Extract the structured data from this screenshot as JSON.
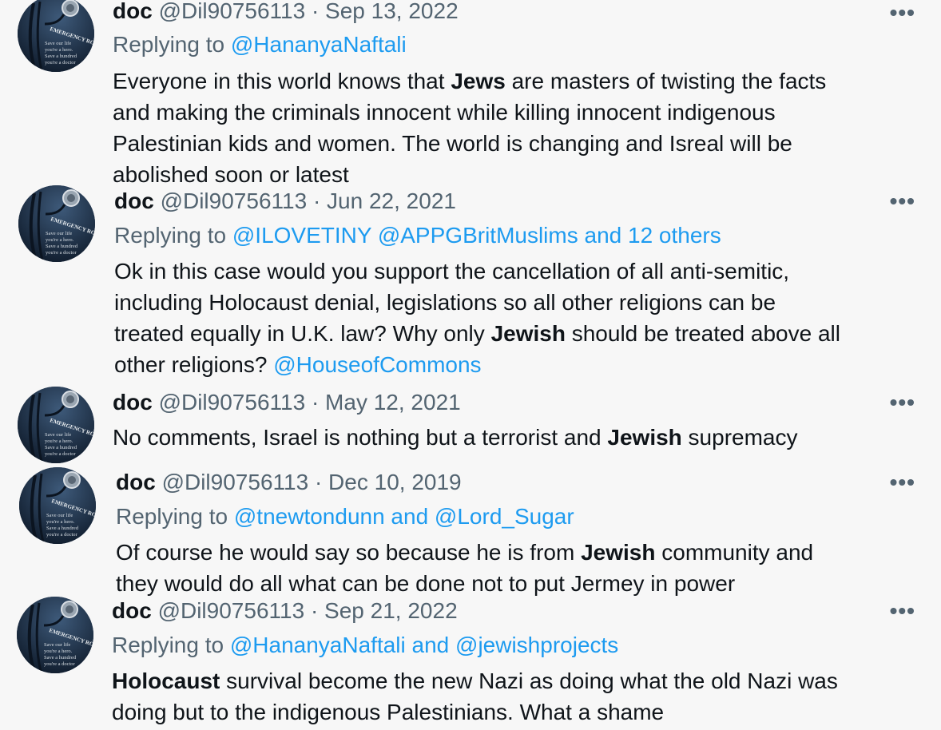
{
  "tweets": [
    {
      "name": "doc",
      "handle": "@Dil90756113",
      "date": "Sep 13, 2022",
      "replying_prefix": "Replying to",
      "replying_to": "@HananyaNaftali",
      "text_lines": [
        [
          "Everyone in this world knows that ",
          "Jews",
          " are masters of twisting the facts"
        ],
        [
          "and making the criminals innocent while killing innocent indigenous",
          "",
          ""
        ],
        [
          "Palestinian kids and women. The world is changing and Isreal will be",
          "",
          ""
        ],
        [
          "abolished soon or latest",
          "",
          ""
        ]
      ]
    },
    {
      "name": "doc",
      "handle": "@Dil90756113",
      "date": "Jun 22, 2021",
      "replying_prefix": "Replying to",
      "replying_to": "@ILOVETINY @APPGBritMuslims and 12 others",
      "text_lines": [
        [
          "Ok in this case would you support the cancellation of all anti-semitic,",
          "",
          ""
        ],
        [
          "including Holocaust denial, legislations so all other religions can be",
          "",
          ""
        ],
        [
          "treated equally in U.K. law? Why only ",
          "Jewish",
          " should be treated above all"
        ],
        [
          "other religions? ",
          "",
          ""
        ]
      ],
      "trailing_mention": "@HouseofCommons"
    },
    {
      "name": "doc",
      "handle": "@Dil90756113",
      "date": "May 12, 2021",
      "text_lines": [
        [
          "No comments, Israel is nothing but a terrorist and ",
          "Jewish",
          " supremacy"
        ]
      ]
    },
    {
      "name": "doc",
      "handle": "@Dil90756113",
      "date": "Dec 10, 2019",
      "replying_prefix": "Replying to",
      "replying_to": "@tnewtondunn and @Lord_Sugar",
      "text_lines": [
        [
          "Of course he would say so because he is from ",
          "Jewish",
          " community and"
        ],
        [
          "they would do all what can be done not to put Jermey in power",
          "",
          ""
        ]
      ]
    },
    {
      "name": "doc",
      "handle": "@Dil90756113",
      "date": "Sep 21, 2022",
      "replying_prefix": "Replying to",
      "replying_to": "@HananyaNaftali and @jewishprojects",
      "text_lines": [
        [
          "",
          "Holocaust",
          " survival become the new Nazi as doing what the old Nazi was"
        ],
        [
          "doing but to the indigenous Palestinians. What a shame",
          "",
          ""
        ]
      ]
    }
  ],
  "separator": "·",
  "more_icon": "•••",
  "avatar_lines": [
    "EMERGENCY ROOM",
    "Save our life",
    "you're a hero.",
    "Save a hundred",
    "you're a doctor"
  ],
  "colors": {
    "accent": "#1d9bf0",
    "muted": "#536471",
    "text": "#0f1419",
    "background": "#f7f7f7"
  }
}
